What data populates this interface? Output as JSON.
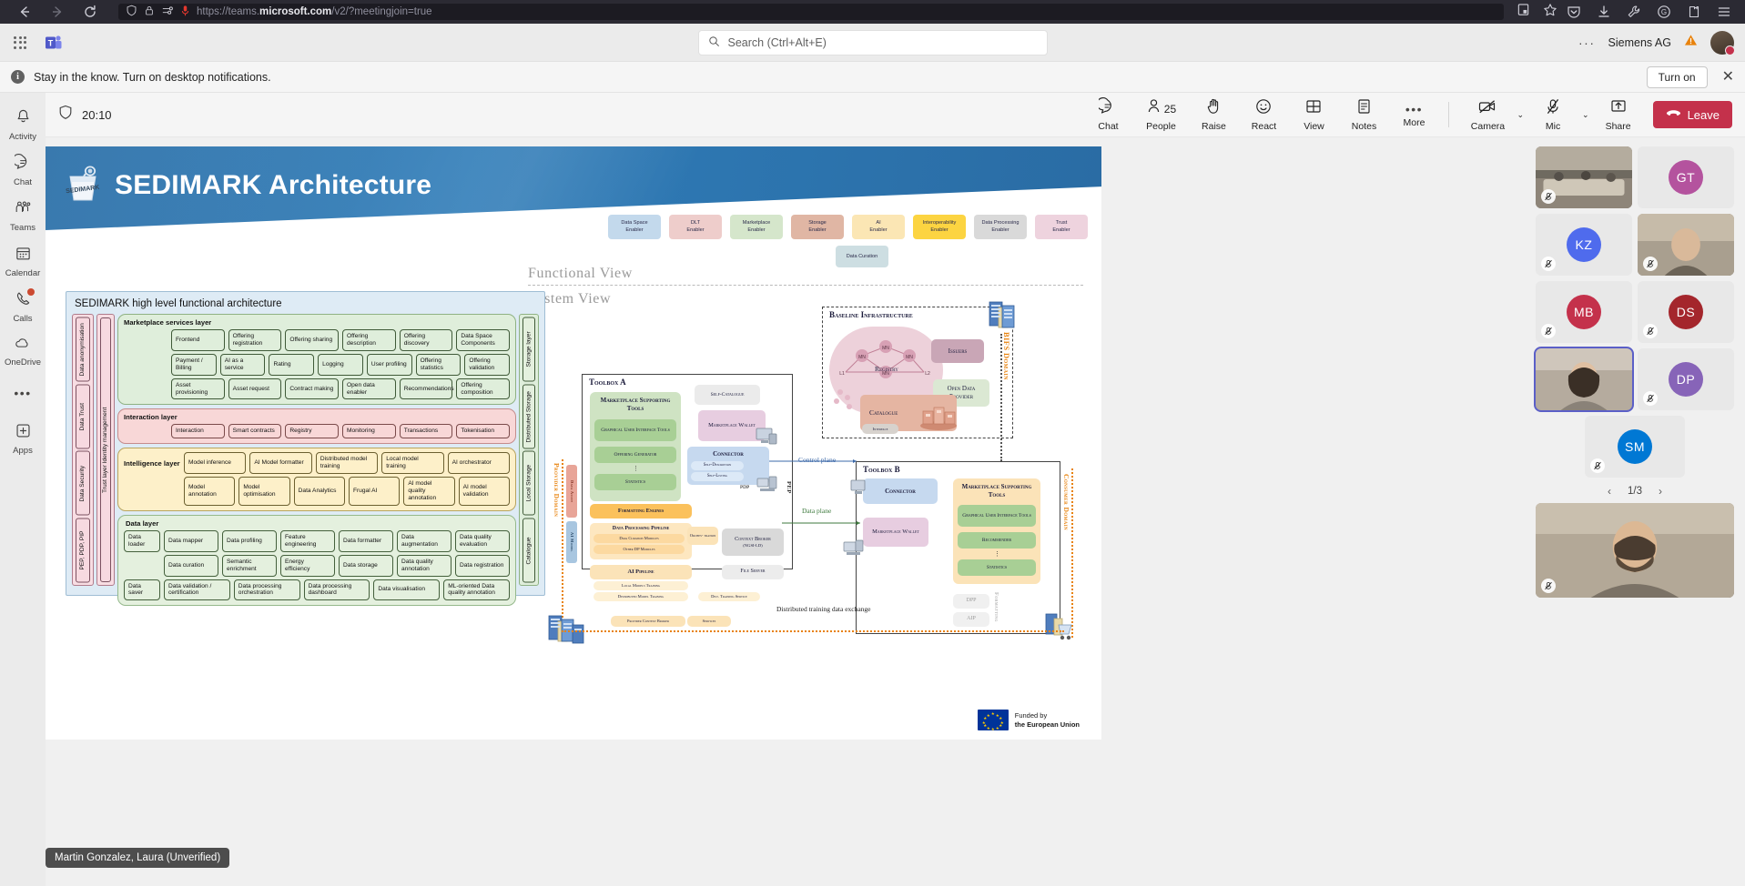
{
  "browser": {
    "url_prefix": "https://teams.",
    "url_domain": "microsoft.com",
    "url_path": "/v2/?meetingjoin=true",
    "back_icon": "back-arrow-icon",
    "forward_icon": "forward-arrow-icon",
    "reload_icon": "reload-icon",
    "shield_icon": "shield-icon",
    "lock_icon": "lock-icon",
    "permissions_icon": "permissions-icon",
    "microphone_icon": "microphone-icon",
    "reader_icon": "reader-view-icon",
    "bookmark_icon": "star-bookmark-icon",
    "pocket_icon": "pocket-icon",
    "downloads_icon": "downloads-icon",
    "tools_icon": "wrench-icon",
    "account_icon": "account-g-icon",
    "extensions_icon": "extensions-icon",
    "menu_icon": "hamburger-menu-icon"
  },
  "topbar": {
    "waffle": "app-launcher-icon",
    "logo": "teams-logo-icon",
    "search_placeholder": "Search (Ctrl+Alt+E)",
    "search_icon": "search-icon",
    "more_dots": "···",
    "org": "Siemens AG",
    "warning_icon": "warning-triangle-icon",
    "avatar": "user-avatar"
  },
  "notification": {
    "info_icon": "info-icon",
    "message": "Stay in the know. Turn on desktop notifications.",
    "turn_on_label": "Turn on",
    "close_label": "✕"
  },
  "rail": {
    "items": [
      {
        "label": "Activity",
        "icon": "bell-icon"
      },
      {
        "label": "Chat",
        "icon": "chat-bubble-icon"
      },
      {
        "label": "Teams",
        "icon": "teams-people-icon"
      },
      {
        "label": "Calendar",
        "icon": "calendar-icon"
      },
      {
        "label": "Calls",
        "icon": "phone-icon",
        "badge": true
      },
      {
        "label": "OneDrive",
        "icon": "cloud-icon"
      },
      {
        "label": "",
        "icon": "more-dots-icon"
      },
      {
        "label": "Apps",
        "icon": "plus-square-icon"
      }
    ]
  },
  "meeting_toolbar": {
    "shield_icon": "meeting-shield-icon",
    "elapsed": "20:10",
    "buttons": [
      {
        "label": "Chat",
        "icon": "chat-icon"
      },
      {
        "label": "People",
        "icon": "people-icon",
        "count": "25"
      },
      {
        "label": "Raise",
        "icon": "raise-hand-icon"
      },
      {
        "label": "React",
        "icon": "react-smiley-icon"
      },
      {
        "label": "View",
        "icon": "view-grid-icon"
      },
      {
        "label": "Notes",
        "icon": "notes-icon"
      },
      {
        "label": "More",
        "icon": "more-dots-icon"
      }
    ],
    "camera": {
      "label": "Camera",
      "icon": "camera-off-icon",
      "chevron": "⌄"
    },
    "mic": {
      "label": "Mic",
      "icon": "mic-off-icon",
      "chevron": "⌄"
    },
    "share": {
      "label": "Share",
      "icon": "share-up-icon"
    },
    "leave": {
      "label": "Leave",
      "icon": "phone-hangup-icon",
      "color": "#c4314b"
    }
  },
  "slide": {
    "title": "SEDIMARK Architecture",
    "logo_text": "SEDIMARK",
    "header_color": "#2f7cb8",
    "enablers": [
      {
        "label1": "Data Space",
        "label2": "Enabler",
        "color": "#c3d9ec"
      },
      {
        "label1": "DLT",
        "label2": "Enabler",
        "color": "#eecdcb"
      },
      {
        "label1": "Marketplace",
        "label2": "Enabler",
        "color": "#d5e6cb"
      },
      {
        "label1": "Storage",
        "label2": "Enabler",
        "color": "#e0b6a4"
      },
      {
        "label1": "AI",
        "label2": "Enabler",
        "color": "#fbe6b4"
      },
      {
        "label1": "Interoperability",
        "label2": "Enabler",
        "color": "#fcd441"
      },
      {
        "label1": "Data Processing",
        "label2": "Enabler",
        "color": "#d9d9d9"
      },
      {
        "label1": "Trust",
        "label2": "Enabler",
        "color": "#eed3de"
      }
    ],
    "data_curation": {
      "label": "Data Curation",
      "color": "#cddee2"
    },
    "functional_view_label": "Functional View",
    "system_view_label": "System View",
    "functional_architecture": {
      "title": "SEDIMARK high level functional architecture",
      "left_columns": [
        "Data anonymisation",
        "Data Trust",
        "Data Security",
        "PEP, PDP, PIP",
        "Trust layer Identity management"
      ],
      "right_columns": [
        "Storage layer",
        "Distributed Storage",
        "Local Storage",
        "Catalogue"
      ],
      "layers": [
        {
          "name": "Marketplace services layer",
          "style": "green",
          "name_inline": false,
          "rows": [
            [
              "Frontend",
              "Offering registration",
              "Offering sharing",
              "Offering description",
              "Offering discovery",
              "Data Space Components"
            ],
            [
              "Payment / Billing",
              "AI as a service",
              "Rating",
              "Logging",
              "User profiling",
              "Offering statistics",
              "Offering validation"
            ],
            [
              "Asset provisioning",
              "Asset request",
              "Contract making",
              "Open data enabler",
              "Recommendations",
              "Offering composition"
            ]
          ]
        },
        {
          "name": "Interaction layer",
          "style": "pink",
          "name_inline": false,
          "rows": [
            [
              "Interaction",
              "Smart contracts",
              "Registry",
              "Monitoring",
              "Transactions",
              "Tokenisation"
            ]
          ]
        },
        {
          "name": "Intelligence layer",
          "style": "yellow",
          "name_inline": true,
          "rows": [
            [
              "Model inference",
              "AI Model formatter",
              "Distributed model training",
              "Local model training",
              "AI orchestrator"
            ],
            [
              "Model annotation",
              "Model optimisation",
              "Data Analytics",
              "Frugal AI",
              "AI model quality annotation",
              "AI model validation"
            ]
          ]
        },
        {
          "name": "Data layer",
          "style": "lightgreen",
          "name_inline": true,
          "rows": [
            [
              "Data mapper",
              "Data profiling",
              "Feature engineering",
              "Data formatter",
              "Data augmentation",
              "Data quality evaluation"
            ],
            [
              "Data curation",
              "Semantic enrichment",
              "Energy efficiency",
              "Data storage",
              "Data quality annotation",
              "Data registration"
            ],
            [
              "Data validation / certification",
              "Data processing orchestration",
              "Data processing dashboard",
              "Data visualisation",
              "ML-oriented Data quality annotation"
            ]
          ],
          "leading_cells": [
            "Data loader",
            "Data saver"
          ]
        }
      ]
    },
    "system_view": {
      "baseline_infrastructure": {
        "title": "Baseline Infrastructure",
        "nodes": [
          "Issuers",
          "Registry",
          "Open Data Provider",
          "Catalogue"
        ],
        "interface_label": "Interface",
        "domain_label": "BIFS Domain",
        "domain_color": "#e8820c"
      },
      "toolbox_a": {
        "title": "Toolbox A",
        "marketplace_supporting_tools": "Marketplace Supporting Tools",
        "tools": [
          "Graphical User Interface Tools",
          "Offering Generator",
          "Statistics"
        ],
        "self_catalogue": "Self-Catalogue",
        "marketplace_wallet": "Marketplace Wallet",
        "connector": "Connector",
        "connector_items": [
          "Self-Description",
          "Self-Listing"
        ],
        "pdp": "PDP",
        "formatting_engines": "Formatting Engines",
        "data_processing_pipeline": "Data Processing Pipeline",
        "dpp_items": [
          "Data Curation Modules",
          "Other DP Modules"
        ],
        "orchestration": "Orches- tration",
        "context_broker": "Context Broker",
        "context_broker_sub": "(NGSI-LD)",
        "ai_pipeline": "AI Pipeline",
        "ai_items": [
          "Local Models Training",
          "Distributed Model Training"
        ],
        "dist_training_service": "Dist. Training Service",
        "file_server": "File Server",
        "pep": "PEP"
      },
      "toolbox_b": {
        "title": "Toolbox B",
        "connector": "Connector",
        "marketplace_wallet": "Marketplace Wallet",
        "marketplace_supporting_tools": "Marketplace Supporting Tools",
        "tools": [
          "Graphical User Interface Tools",
          "Recommender",
          "Statistics"
        ],
        "dpp": "DPP",
        "aip": "AIP",
        "formatting": "Formatting"
      },
      "provider_domain": "Provider Domain",
      "consumer_domain": "Consumer Domain",
      "ai_model_label": "AI Model",
      "data_asset_label": "Data Asset",
      "control_plane": "Control plane",
      "data_plane": "Data plane",
      "provider_context_broker": "Provider Context Broker",
      "services": "Services",
      "distributed_training": "Distributed training data exchange"
    },
    "footer": {
      "line1": "Funded by",
      "line2": "the European Union"
    }
  },
  "participants": {
    "tiles": [
      {
        "type": "photo",
        "style": "photo-room",
        "muted": true,
        "name": ""
      },
      {
        "type": "initials",
        "initials": "GT",
        "color": "#b4539e",
        "muted": false
      },
      {
        "type": "initials",
        "initials": "KZ",
        "color": "#4f6bed",
        "muted": true
      },
      {
        "type": "photo",
        "style": "photo-man",
        "muted": true
      },
      {
        "type": "initials",
        "initials": "MB",
        "color": "#c4314b",
        "muted": true
      },
      {
        "type": "initials",
        "initials": "DS",
        "color": "#a4262c",
        "muted": true
      },
      {
        "type": "photo",
        "style": "photo-woman",
        "muted": false,
        "active": true
      },
      {
        "type": "initials",
        "initials": "DP",
        "color": "#8764b8",
        "muted": true
      }
    ],
    "single_tile": {
      "initials": "SM",
      "color": "#0078d4",
      "muted": true
    },
    "pager": {
      "text": "1/3",
      "prev": "‹",
      "next": "›"
    },
    "bottom_tile": {
      "style": "photo-beard",
      "muted": true
    }
  },
  "name_tag": "Martin Gonzalez, Laura (Unverified)"
}
